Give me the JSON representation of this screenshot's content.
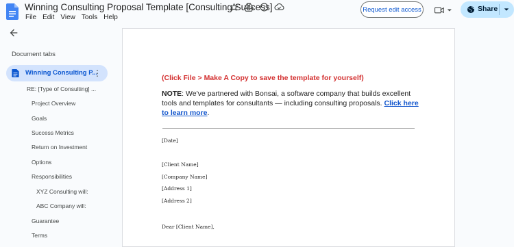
{
  "header": {
    "title": "Winning Consulting Proposal Template [Consulting Success]",
    "menu": [
      "File",
      "Edit",
      "View",
      "Tools",
      "Help"
    ],
    "request_edit_label": "Request edit access",
    "share_label": "Share"
  },
  "sidebar": {
    "heading": "Document tabs",
    "active_tab": "Winning Consulting P...",
    "outline": [
      {
        "label": "RE: [Type of Consulting] ..."
      },
      {
        "label": "Project Overview"
      },
      {
        "label": "Goals"
      },
      {
        "label": "Success Metrics"
      },
      {
        "label": "Return on Investment"
      },
      {
        "label": "Options"
      },
      {
        "label": "Responsibilities"
      },
      {
        "label": "XYZ Consulting will:"
      },
      {
        "label": "ABC Company will:"
      },
      {
        "label": "Guarantee"
      },
      {
        "label": "Terms"
      }
    ]
  },
  "document": {
    "copy_note": "(Click File > Make A Copy to save the template for yourself)",
    "note_bold": "NOTE",
    "note_text": ": We've partnered with Bonsai, a software company that builds excellent tools and templates for consultants — including consulting proposals. ",
    "note_link": "Click here to learn more",
    "note_end": ".",
    "date": "[Date]",
    "client_name": "[Client Name]",
    "company_name": "[Company Name]",
    "address1": "[Address 1]",
    "address2": "[Address 2]",
    "salutation": "Dear [Client Name],"
  },
  "colors": {
    "accent": "#0b57d0",
    "active_tab_bg": "#d3e3fd",
    "share_bg": "#c2e7ff",
    "copy_note": "#d32f2f",
    "link": "#1155cc"
  },
  "icons": [
    "docs-logo-icon",
    "star-icon",
    "move-to-drive-icon",
    "info-icon",
    "cloud-status-icon",
    "meet-icon",
    "globe-icon",
    "back-arrow-icon",
    "doc-tab-icon",
    "more-vert-icon",
    "dropdown-icon"
  ]
}
